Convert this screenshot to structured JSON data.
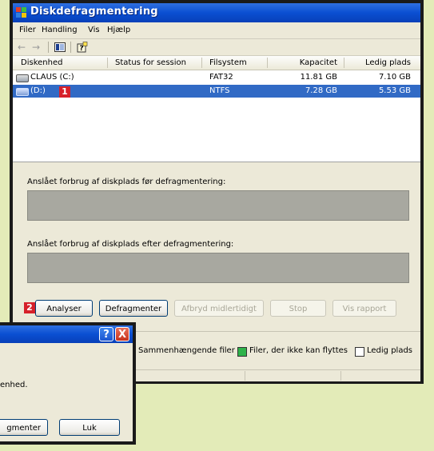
{
  "window": {
    "title": "Diskdefragmentering"
  },
  "menu": [
    "Filer",
    "Handling",
    "Vis",
    "Hjælp"
  ],
  "toolbar": {
    "back": "←",
    "forward": "→"
  },
  "columns": [
    "Diskenhed",
    "Status for session",
    "Filsystem",
    "Kapacitet",
    "Ledig plads"
  ],
  "volumes": [
    {
      "name": "CLAUS (C:)",
      "status": "",
      "fs": "FAT32",
      "capacity": "11.81 GB",
      "free": "7.10 GB"
    },
    {
      "name": "(D:)",
      "status": "",
      "fs": "NTFS",
      "capacity": "7.28 GB",
      "free": "5.53 GB"
    }
  ],
  "markers": {
    "one": "1",
    "two": "2"
  },
  "labels": {
    "before": "Anslået forbrug af diskplads før defragmentering:",
    "after": "Anslået forbrug af diskplads efter defragmentering:"
  },
  "buttons": {
    "analyze": "Analyser",
    "defrag": "Defragmenter",
    "pause": "Afbryd midlertidigt",
    "stop": "Stop",
    "report": "Vis rapport"
  },
  "legend": [
    {
      "label": "Sammenhængende filer",
      "color": ""
    },
    {
      "label": "Filer, der ikke kan flyttes",
      "color": "#2fb34a"
    },
    {
      "label": "Ledig plads",
      "color": "#ffffff"
    }
  ],
  "dialog": {
    "help": "?",
    "close": "X",
    "message": "enhed.",
    "defrag_button": "gmenter",
    "close_button": "Luk"
  }
}
